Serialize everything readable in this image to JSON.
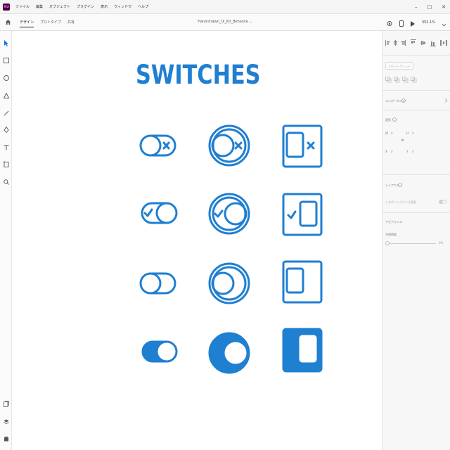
{
  "app": {
    "logo_text": "Xd",
    "brand_color": "#470137",
    "accent_color": "#1f7fd1"
  },
  "menu": {
    "items": [
      "ファイル",
      "編集",
      "オブジェクト",
      "プラグイン",
      "表示",
      "ウィンドウ",
      "ヘルプ"
    ]
  },
  "window_controls": {
    "minimize": "–",
    "maximize": "□",
    "close": "✕"
  },
  "tabs": {
    "items": [
      "デザイン",
      "プロトタイプ",
      "共有"
    ],
    "active_index": 0
  },
  "document": {
    "title": "Hand-drawn_UI_Kit_Behance",
    "title_suffix": "⌄"
  },
  "toolbar_right": {
    "zoom_level": "352.1%"
  },
  "left_tools": [
    "select-icon",
    "rectangle-icon",
    "ellipse-icon",
    "polygon-icon",
    "line-icon",
    "pen-icon",
    "text-icon",
    "artboard-icon",
    "zoom-icon",
    "pages-icon",
    "layers-icon",
    "plugins-icon"
  ],
  "canvas": {
    "title": "SWITCHES"
  },
  "switches": [
    [
      "pill-off-x",
      "round-off-x",
      "square-off-x"
    ],
    [
      "pill-on-check",
      "round-on-check",
      "square-on-check"
    ],
    [
      "pill-off",
      "round-off",
      "square-off"
    ],
    [
      "pill-filled",
      "round-filled",
      "square-filled"
    ]
  ],
  "panel": {
    "repeat_grid": "リピートグリッド",
    "component": "コンポーネント",
    "transform": "変形",
    "w_label": "W",
    "h_label": "H",
    "x_label": "X",
    "y_label": "Y",
    "w_value": "0",
    "h_value": "0",
    "x_value": "0",
    "y_value": "0",
    "layout": "レイアウト",
    "responsive_resize": "レスポンシブサイズ変更",
    "appearance": "アピアランス",
    "opacity_label": "不透明度",
    "opacity_value": "0%"
  }
}
